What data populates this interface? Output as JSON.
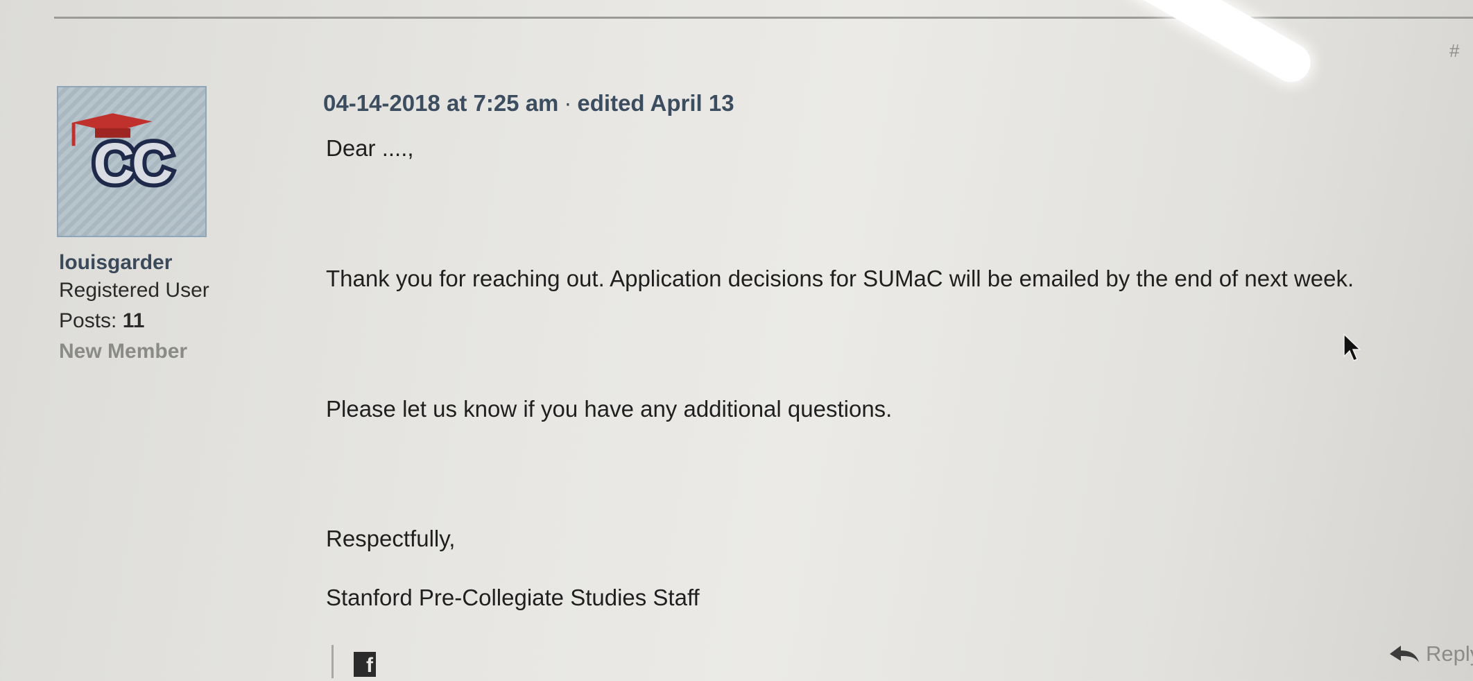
{
  "post": {
    "permalink_symbol": "#",
    "author": {
      "name": "louisgarder",
      "role": "Registered User",
      "posts_label": "Posts:",
      "posts_count": "11",
      "rank": "New Member",
      "avatar_text": "CC"
    },
    "meta": {
      "date": "04-14-2018 at 7:25 am",
      "separator": "·",
      "edited": "edited April 13"
    },
    "body": {
      "greeting": "Dear ....,",
      "line1": "Thank you for reaching out. Application decisions for SUMaC will be emailed by the end of next week.",
      "line2": "Please let us know if you have any additional questions.",
      "closing": "Respectfully,",
      "signature": "Stanford Pre-Collegiate Studies Staff"
    },
    "footer": {
      "facebook_glyph": "f",
      "reply_label": "Reply"
    }
  },
  "icons": {
    "avatar": "cc-graduation-cap-logo",
    "facebook": "facebook-icon",
    "reply": "reply-arrow-icon",
    "cursor": "mouse-pointer-icon"
  },
  "colors": {
    "author_name": "#3b4a5a",
    "meta": "#3c4d60",
    "rank": "#8a8a88",
    "cap_red": "#c0302c",
    "logo_navy": "#1f2a4a"
  }
}
